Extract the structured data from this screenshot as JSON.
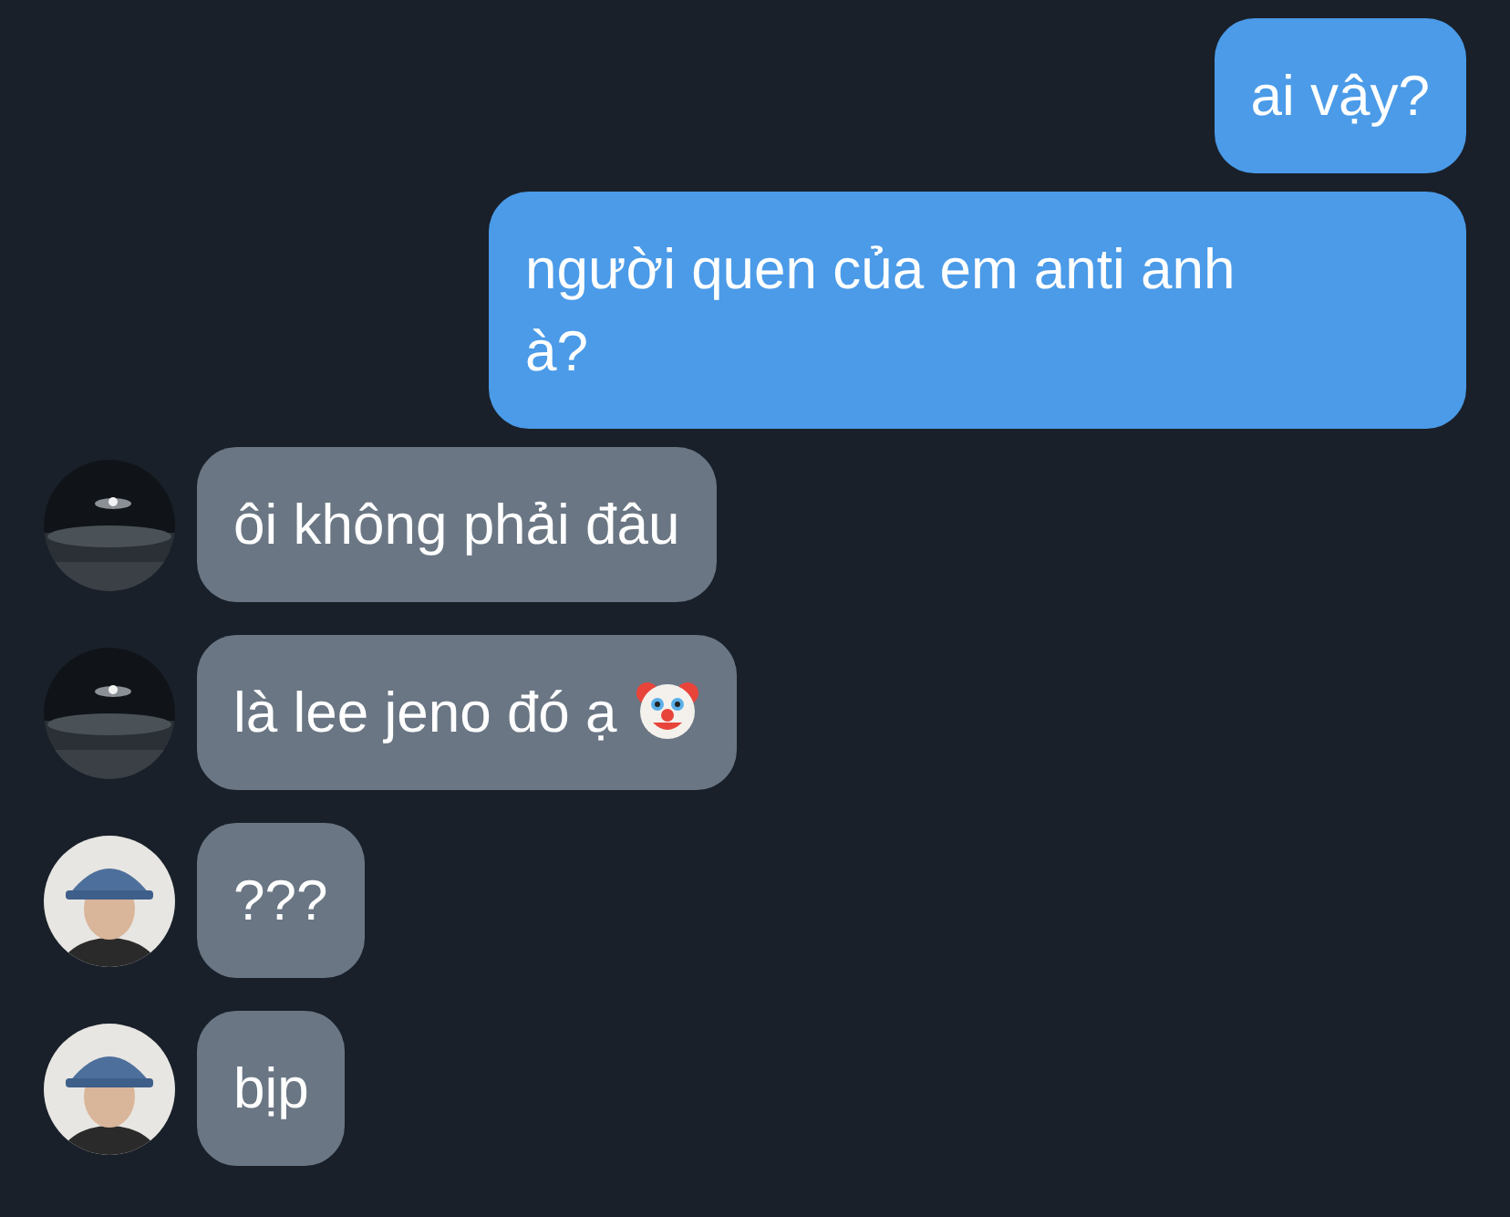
{
  "messages": [
    {
      "kind": "outgoing",
      "text": "ai vậy?"
    },
    {
      "kind": "outgoing",
      "text": "người quen của em anti anh à?"
    },
    {
      "kind": "incoming",
      "avatar": {
        "kind": "scene"
      },
      "text": "ôi không phải đâu"
    },
    {
      "kind": "incoming",
      "avatar": {
        "kind": "scene"
      },
      "text": "là lee jeno đó ạ",
      "trailing_icon": {
        "kind": "clown"
      }
    },
    {
      "kind": "incoming",
      "avatar": {
        "kind": "figure"
      },
      "text": "???"
    },
    {
      "kind": "incoming",
      "avatar": {
        "kind": "figure"
      },
      "text": "bịp"
    }
  ]
}
